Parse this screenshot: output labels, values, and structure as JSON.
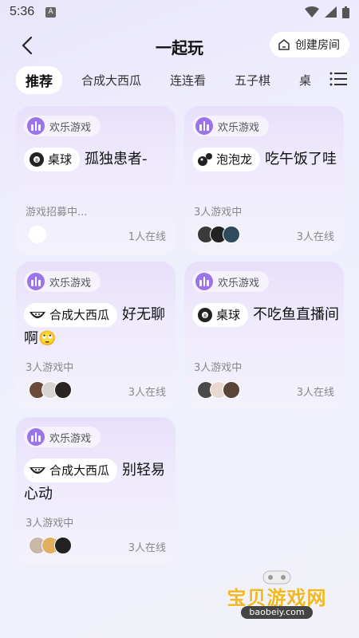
{
  "status_bar": {
    "time": "5:36",
    "a_badge": "A"
  },
  "header": {
    "title": "一起玩",
    "create_room": "创建房间"
  },
  "tabs": [
    "推荐",
    "合成大西瓜",
    "连连看",
    "五子棋",
    "桌"
  ],
  "cards": [
    {
      "tag": "欢乐游戏",
      "game": "桌球",
      "game_icon": "8-ball-icon",
      "room": "孤独患者-",
      "players": "游戏招募中...",
      "online": "1人在线"
    },
    {
      "tag": "欢乐游戏",
      "game": "泡泡龙",
      "game_icon": "bubble-icon",
      "room": "吃午饭了哇",
      "players": "3人游戏中",
      "online": "3人在线"
    },
    {
      "tag": "欢乐游戏",
      "game": "合成大西瓜",
      "game_icon": "watermelon-icon",
      "room": "好无聊啊🙄",
      "players": "3人游戏中",
      "online": "3人在线"
    },
    {
      "tag": "欢乐游戏",
      "game": "桌球",
      "game_icon": "8-ball-icon",
      "room": "不吃鱼直播间",
      "players": "3人游戏中",
      "online": "3人在线"
    },
    {
      "tag": "欢乐游戏",
      "game": "合成大西瓜",
      "game_icon": "watermelon-icon",
      "room": "别轻易心动",
      "players": "3人游戏中",
      "online": "3人在线"
    }
  ],
  "watermark": {
    "text": "宝贝游戏网",
    "url": "baobeiy.com"
  },
  "colors": {
    "accent": "#9a74e8",
    "card_top": "#e8e0fb",
    "watermark": "#f2b824"
  }
}
